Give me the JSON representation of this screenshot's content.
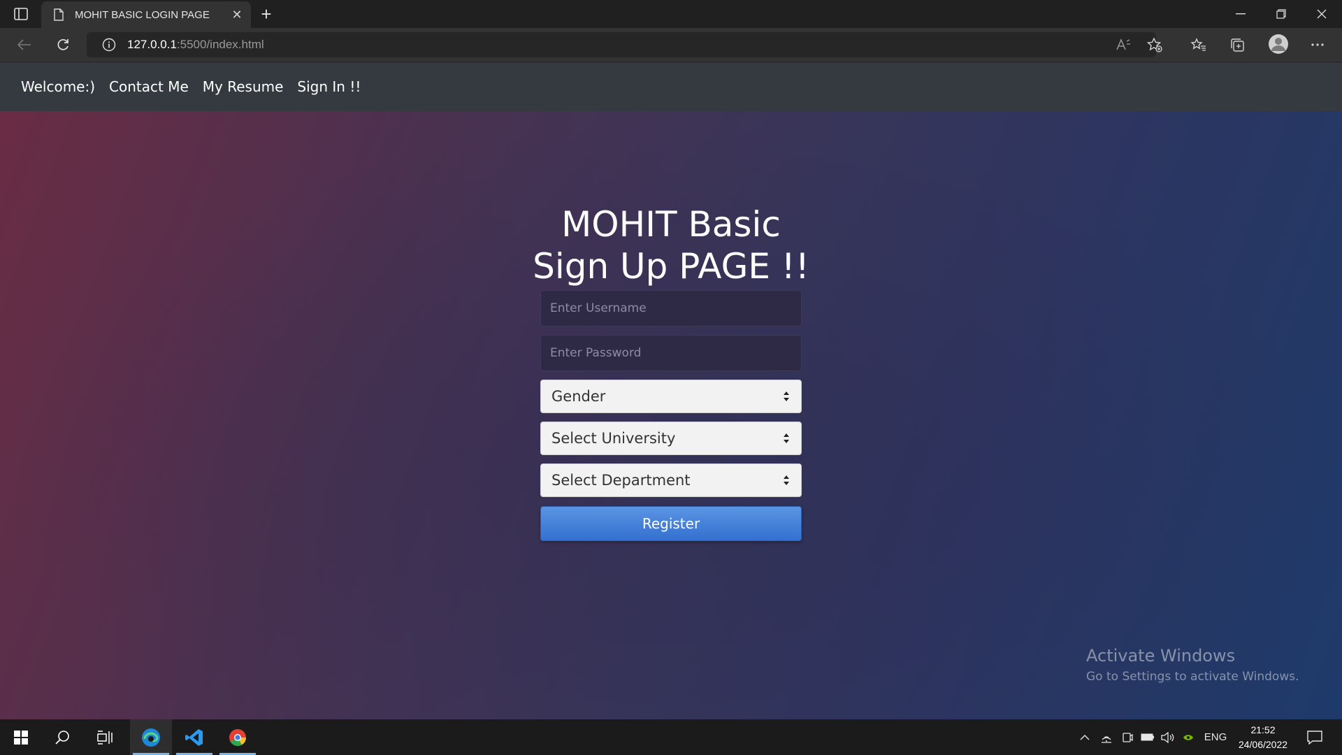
{
  "browser": {
    "tab_title": "MOHIT BASIC LOGIN PAGE",
    "url_host": "127.0.0.1",
    "url_rest": ":5500/index.html",
    "icons": [
      "tab-actions-icon",
      "document-icon",
      "close-icon",
      "plus-icon",
      "minimize-icon",
      "restore-icon",
      "window-close-icon",
      "back-icon",
      "refresh-icon",
      "info-icon",
      "read-aloud-icon",
      "add-favorite-icon",
      "favorites-icon",
      "collections-icon",
      "profile-icon",
      "more-icon"
    ]
  },
  "navbar": {
    "items": [
      "Welcome:)",
      "Contact Me",
      "My Resume",
      "Sign In !!"
    ]
  },
  "form": {
    "title_line1": "MOHIT Basic",
    "title_line2": "Sign Up PAGE !!",
    "username_placeholder": "Enter Username",
    "password_placeholder": "Enter Password",
    "gender": "Gender",
    "university": "Select University",
    "department": "Select Department",
    "register": "Register"
  },
  "watermark": {
    "line1": "Activate Windows",
    "line2": "Go to Settings to activate Windows."
  },
  "taskbar": {
    "language": "ENG",
    "time": "21:52",
    "date": "24/06/2022"
  },
  "colors": {
    "navbar": "#343a40",
    "register": "#3f7fd8",
    "gradient_start": "#6a2c44",
    "gradient_end": "#1e3a6a"
  }
}
